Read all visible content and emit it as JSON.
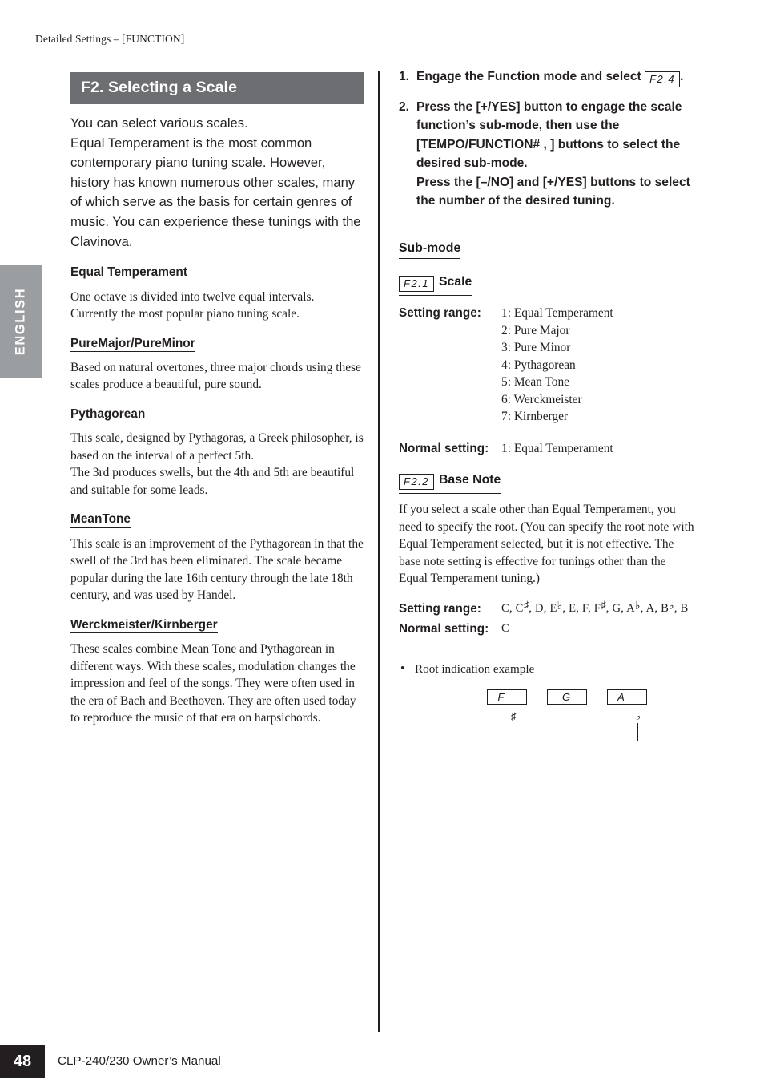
{
  "page": {
    "running_head": "Detailed Settings – [FUNCTION]",
    "side_tab_label": "ENGLISH",
    "page_number": "48",
    "footer_text": "CLP-240/230 Owner’s Manual"
  },
  "left_column": {
    "section_title": "F2. Selecting a Scale",
    "intro": "You can select various scales.\nEqual Temperament is the most common contemporary piano tuning scale. However, history has known numerous other scales, many of which serve as the basis for certain genres of music. You can experience these tunings with the Clavinova.",
    "subsections": [
      {
        "heading": "Equal Temperament",
        "body": "One octave is divided into twelve equal intervals. Currently the most popular piano tuning scale."
      },
      {
        "heading": "PureMajor/PureMinor",
        "body": "Based on natural overtones, three major chords using these scales produce a beautiful, pure sound."
      },
      {
        "heading": "Pythagorean",
        "body": "This scale, designed by Pythagoras, a Greek philosopher, is based on the interval of a perfect 5th.\nThe 3rd produces swells, but the 4th and 5th are beautiful and suitable for some leads."
      },
      {
        "heading": "MeanTone",
        "body": "This scale is an improvement of the Pythagorean in that the swell of the 3rd has been eliminated. The scale became popular during the late 16th century through the late 18th century, and was used by Handel."
      },
      {
        "heading": "Werckmeister/Kirnberger",
        "body": "These scales combine Mean Tone and Pythagorean in different ways. With these scales, modulation changes the impression and feel of the songs. They were often used in the era of Bach and Beethoven. They are often used today to reproduce the music of that era on harpsichords."
      }
    ]
  },
  "right_column": {
    "steps": [
      {
        "number": "1.",
        "text_before": "Engage the Function mode and select ",
        "lcd": "F2.4",
        "text_after": "."
      },
      {
        "number": "2.",
        "text": "Press the [+/YES] button to engage the scale function’s sub-mode, then use the [TEMPO/FUNCTION#   ,   ] buttons to select the desired sub-mode.\nPress the [–/NO] and [+/YES] buttons to select the number of the desired tuning."
      }
    ],
    "submode_heading": "Sub-mode",
    "parameters": [
      {
        "lcd": "F2.1",
        "label": "Scale",
        "setting_range_label": "Setting range:",
        "setting_range_values": [
          "1: Equal Temperament",
          "2: Pure Major",
          "3: Pure Minor",
          "4: Pythagorean",
          "5: Mean Tone",
          "6: Werckmeister",
          "7: Kirnberger"
        ],
        "normal_setting_label": "Normal setting:",
        "normal_setting_value": "1: Equal Temperament"
      },
      {
        "lcd": "F2.2",
        "label": "Base Note",
        "body": "If you select a scale other than Equal Temperament, you need to specify the root. (You can specify the root note with Equal Temperament selected, but it is not effective. The base note setting is effective for tunings other than the Equal Temperament tuning.)",
        "setting_range_label": "Setting range:",
        "setting_range_notes": "C, C♯, D, E♭, E, F, F♯, G, A♭, A, B♭, B",
        "normal_setting_label": "Normal setting:",
        "normal_setting_value": "C"
      }
    ],
    "root_example": {
      "bullet": "•",
      "caption": "Root indication example",
      "displays": [
        {
          "value": "F",
          "indicator": "top",
          "accidental": "♯"
        },
        {
          "value": "G",
          "indicator": "none",
          "accidental": ""
        },
        {
          "value": "A",
          "indicator": "bottom",
          "accidental": "♭"
        }
      ]
    }
  }
}
